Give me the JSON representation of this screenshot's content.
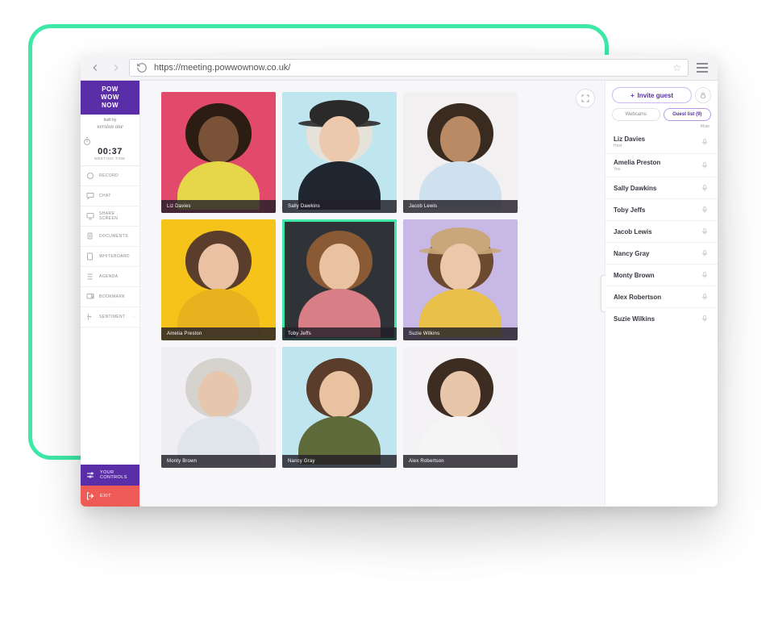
{
  "browser": {
    "url": "https://meeting.powwownow.co.uk/"
  },
  "brand": {
    "line1": "POW",
    "line2": "WOW",
    "line3": "NOW"
  },
  "built_by": {
    "label": "built by",
    "name": "version one"
  },
  "timer": {
    "time": "00:37",
    "label": "MEETING TIME"
  },
  "sidebar": {
    "items": [
      {
        "id": "record",
        "label": "RECORD",
        "icon": "record"
      },
      {
        "id": "chat",
        "label": "CHAT",
        "icon": "chat"
      },
      {
        "id": "share",
        "label": "SHARE SCREEN",
        "icon": "share"
      },
      {
        "id": "documents",
        "label": "DOCUMENTS",
        "icon": "documents"
      },
      {
        "id": "whiteboard",
        "label": "WHITEBOARD",
        "icon": "whiteboard"
      },
      {
        "id": "agenda",
        "label": "AGENDA",
        "icon": "agenda"
      },
      {
        "id": "bookmark",
        "label": "BOOKMARK",
        "icon": "bookmark"
      },
      {
        "id": "sentiment",
        "label": "SENTIMENT",
        "icon": "sentiment",
        "chevron": true
      }
    ],
    "your_controls": "YOUR CONTROLS",
    "exit": "EXIT"
  },
  "grid": {
    "tiles": [
      {
        "name": "Liz Davies",
        "bg": "#e14a6a",
        "skin": "#7a5238",
        "hair": "#2b1c14",
        "shirt": "#e6d74a"
      },
      {
        "name": "Sally Dawkins",
        "bg": "#bfe5ef",
        "skin": "#ecc9ad",
        "hair": "#e5e2da",
        "shirt": "#1f2630",
        "hat": "#2a2a2a"
      },
      {
        "name": "Jacob Lewis",
        "bg": "#f3f0f2",
        "skin": "#b98a64",
        "hair": "#3a2b20",
        "shirt": "#cfe1ee"
      },
      {
        "name": "Amelia Preston",
        "bg": "#f6c31a",
        "skin": "#eac1a3",
        "hair": "#5a3d2a",
        "shirt": "#e7b21d"
      },
      {
        "name": "Toby Jeffs",
        "bg": "#2f3236",
        "skin": "#e9c2a2",
        "hair": "#8a5a34",
        "shirt": "#d77e86",
        "active": true
      },
      {
        "name": "Suzie Wilkins",
        "bg": "#c7b8e6",
        "skin": "#ecc7a9",
        "hair": "#6b4a30",
        "shirt": "#e8c04a",
        "hat": "#c9a77a"
      },
      {
        "name": "Monty Brown",
        "bg": "#efeef2",
        "skin": "#e6c7ad",
        "hair": "#d6d3cf",
        "shirt": "#dfe5ea"
      },
      {
        "name": "Nancy Gray",
        "bg": "#bfe5ef",
        "skin": "#e9c2a2",
        "hair": "#5a3d2a",
        "shirt": "#5f6a3a"
      },
      {
        "name": "Alex Robertson",
        "bg": "#f4f2f5",
        "skin": "#e8c6aa",
        "hair": "#3c2c22",
        "shirt": "#f5f5f5"
      }
    ]
  },
  "panel": {
    "invite": "Invite guest",
    "tab_webcams": "Webcams",
    "tab_guestlist": "Guest list (9)",
    "mute": "Mute",
    "guests": [
      {
        "name": "Liz Davies",
        "sub": "Host"
      },
      {
        "name": "Amelia Preston",
        "sub": "You"
      },
      {
        "name": "Sally Dawkins"
      },
      {
        "name": "Toby Jeffs"
      },
      {
        "name": "Jacob Lewis"
      },
      {
        "name": "Nancy Gray"
      },
      {
        "name": "Monty Brown"
      },
      {
        "name": "Alex Robertson"
      },
      {
        "name": "Suzie Wilkins"
      }
    ]
  }
}
